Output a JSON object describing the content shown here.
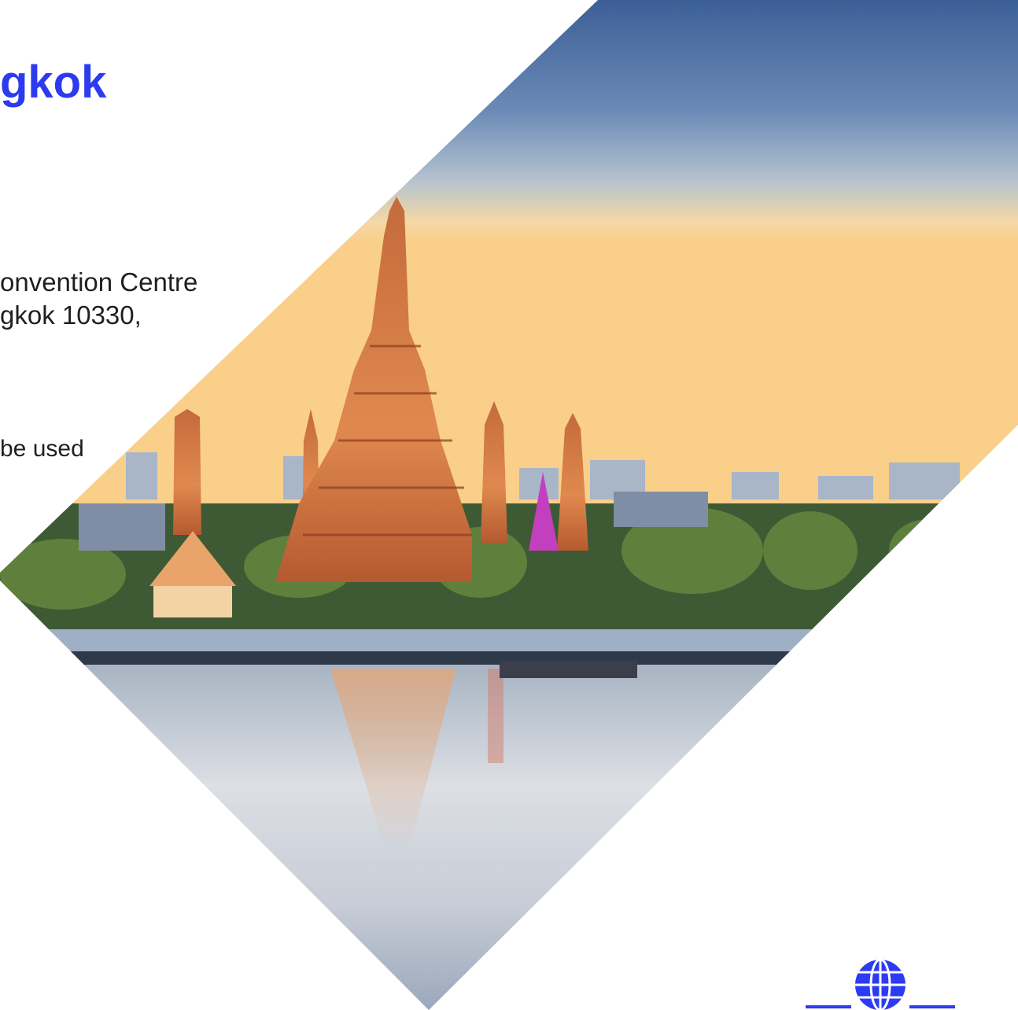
{
  "slide": {
    "title": "gkok",
    "address_lines": [
      "onvention Centre",
      "gkok 10330,"
    ],
    "note": "be used"
  },
  "colors": {
    "title": "#2c3bf0",
    "text": "#1f1f1f",
    "logo": "#2c3bf0"
  },
  "icons": {
    "logo": "globe-icon"
  }
}
